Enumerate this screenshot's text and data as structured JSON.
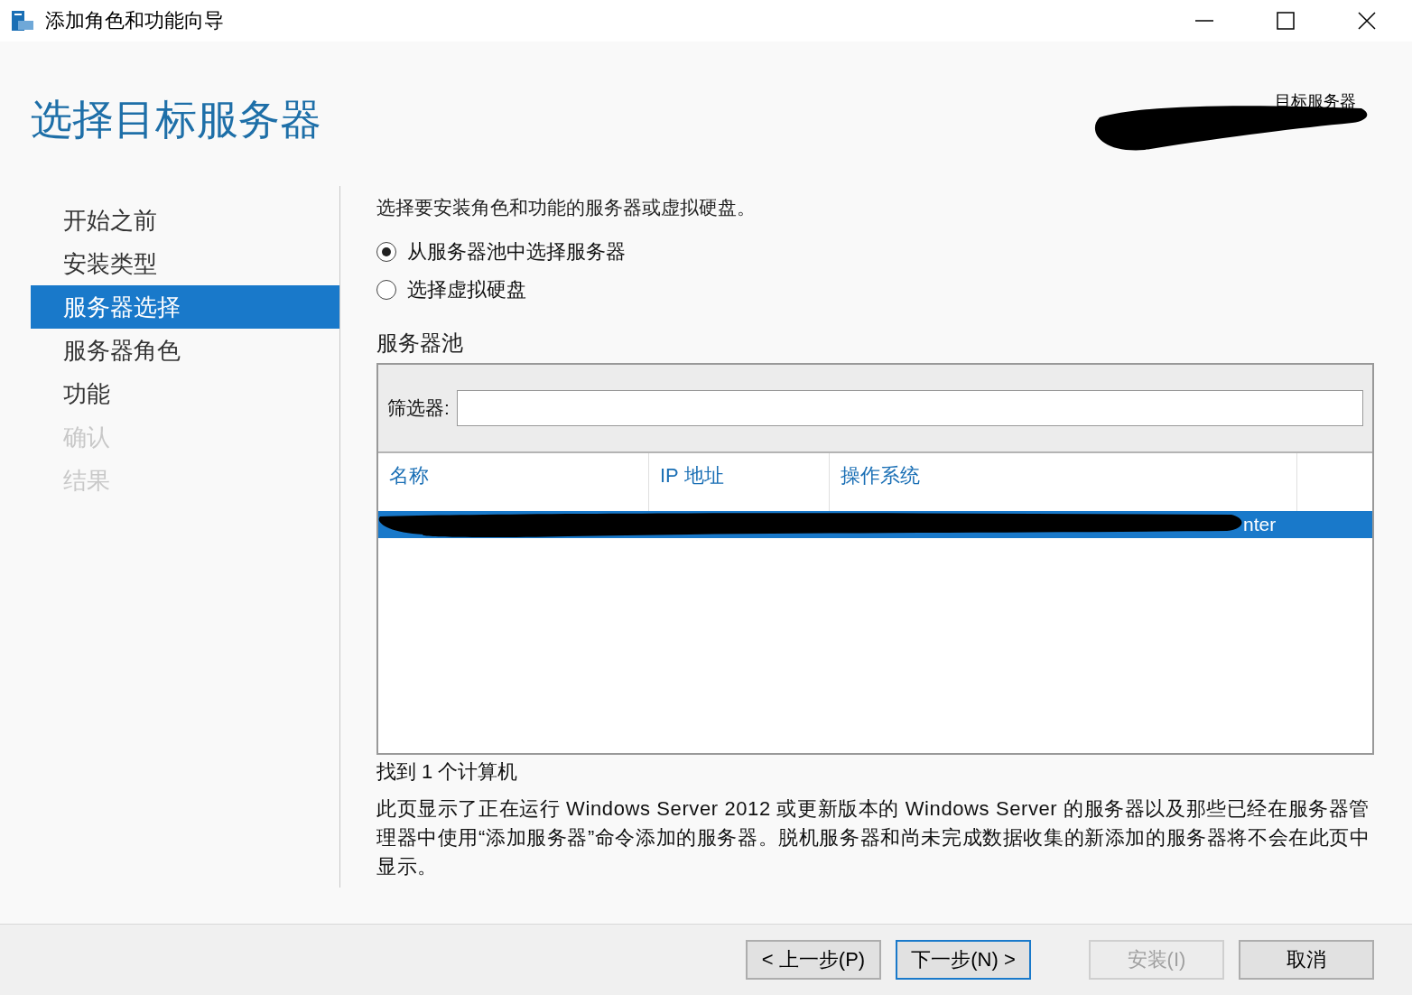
{
  "window": {
    "title": "添加角色和功能向导"
  },
  "header": {
    "title": "选择目标服务器",
    "target_label": "目标服务器"
  },
  "nav": [
    {
      "label": "开始之前",
      "selected": false,
      "disabled": false
    },
    {
      "label": "安装类型",
      "selected": false,
      "disabled": false
    },
    {
      "label": "服务器选择",
      "selected": true,
      "disabled": false
    },
    {
      "label": "服务器角色",
      "selected": false,
      "disabled": false
    },
    {
      "label": "功能",
      "selected": false,
      "disabled": false
    },
    {
      "label": "确认",
      "selected": false,
      "disabled": true
    },
    {
      "label": "结果",
      "selected": false,
      "disabled": true
    }
  ],
  "instruction": "选择要安装角色和功能的服务器或虚拟硬盘。",
  "options": [
    {
      "label": "从服务器池中选择服务器",
      "selected": true
    },
    {
      "label": "选择虚拟硬盘",
      "selected": false
    }
  ],
  "pool": {
    "title": "服务器池",
    "filter_label": "筛选器:",
    "columns": [
      "名称",
      "IP 地址",
      "操作系统"
    ],
    "rows": [
      {
        "column_3": "nter",
        "selected": true
      }
    ]
  },
  "count": "找到 1 个计算机",
  "note": "此页显示了正在运行 Windows Server 2012 或更新版本的 Windows Server 的服务器以及那些已经在服务器管理器中使用“添加服务器”命令添加的服务器。脱机服务器和尚未完成数据收集的新添加的服务器将不会在此页中显示。",
  "buttons": [
    {
      "label": "< 上一步(P)",
      "disabled": false,
      "default": false
    },
    {
      "label": "下一步(N) >",
      "disabled": false,
      "default": true
    },
    {
      "label": "安装(I)",
      "disabled": true,
      "default": false
    },
    {
      "label": "取消",
      "disabled": false,
      "default": false
    }
  ]
}
